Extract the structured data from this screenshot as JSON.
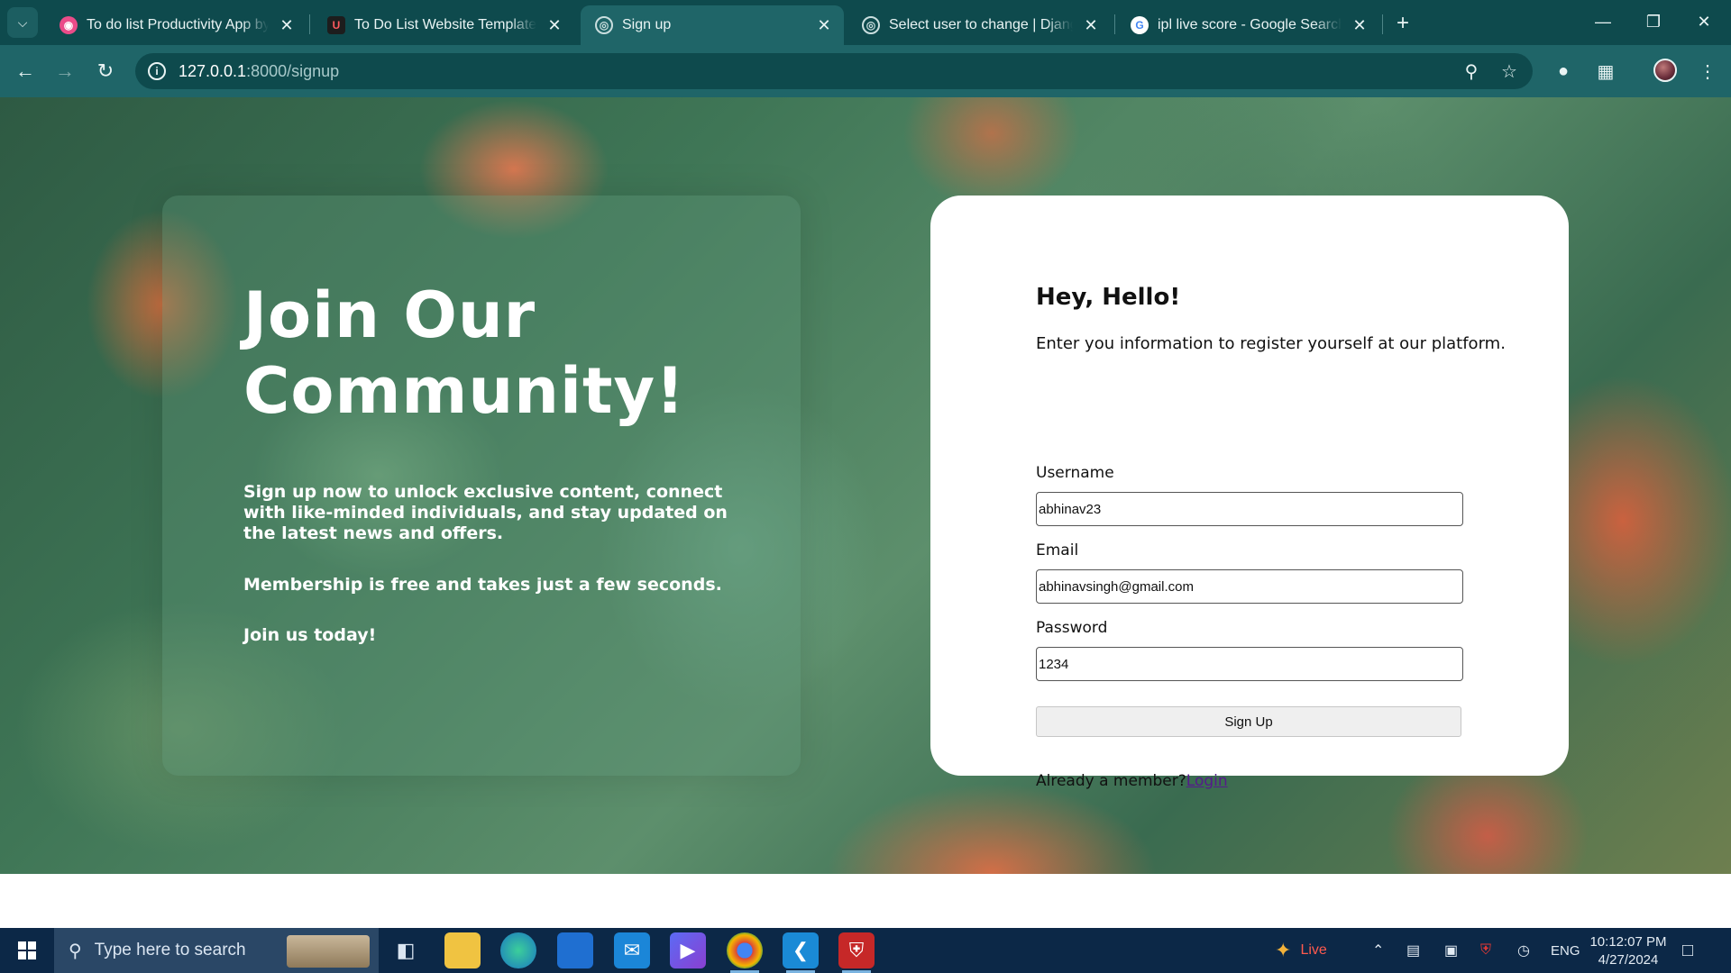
{
  "browser": {
    "tabs": [
      {
        "title": "To do list Productivity App by H",
        "favicon": "dribbble-icon",
        "active": false
      },
      {
        "title": "To Do List Website Template | U",
        "favicon": "u-logo-icon",
        "active": false
      },
      {
        "title": "Sign up",
        "favicon": "globe-icon",
        "active": true
      },
      {
        "title": "Select user to change | Django s",
        "favicon": "globe-icon",
        "active": false
      },
      {
        "title": "ipl live score - Google Search",
        "favicon": "google-icon",
        "active": false
      }
    ],
    "address": {
      "host": "127.0.0.1",
      "path": ":8000/signup"
    }
  },
  "hero": {
    "title": "Join Our Community!",
    "paragraph1": "Sign up now to unlock exclusive content, connect with like-minded individuals, and stay updated on the latest news and offers.",
    "paragraph2": "Membership is free and takes just a few seconds.",
    "paragraph3": "Join us today!"
  },
  "form": {
    "title": "Hey, Hello!",
    "subtitle": "Enter you information to register yourself at our platform.",
    "username_label": "Username",
    "username_value": "abhinav23",
    "email_label": "Email",
    "email_value": "abhinavsingh@gmail.com",
    "password_label": "Password",
    "password_value": "1234",
    "submit_label": "Sign Up",
    "already_text": "Already a member?",
    "login_link": "Login"
  },
  "taskbar": {
    "search_placeholder": "Type here to search",
    "live_label": "Live",
    "language": "ENG",
    "time": "10:12:07 PM",
    "date": "4/27/2024"
  }
}
